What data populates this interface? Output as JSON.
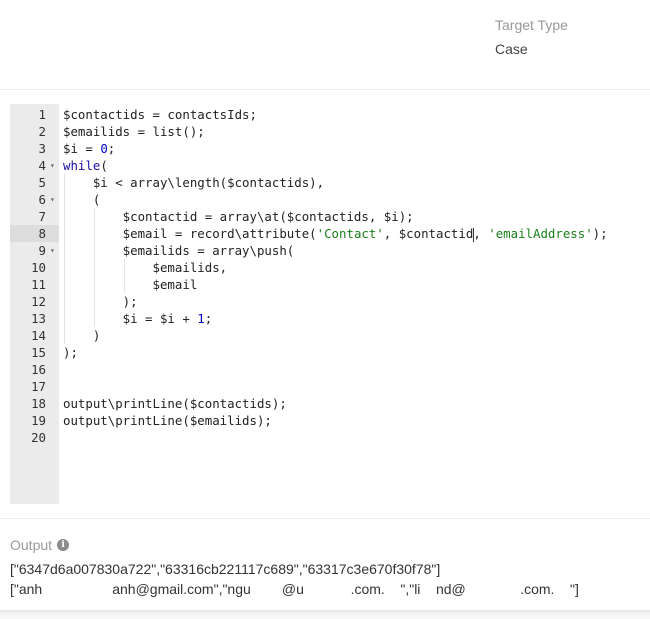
{
  "target_type": {
    "label": "Target Type",
    "value": "Case"
  },
  "editor": {
    "active_line": 8,
    "lines": [
      {
        "n": "1",
        "fold": false,
        "html": "$contactids = contactsIds;"
      },
      {
        "n": "2",
        "fold": false,
        "html": "$emailids = list();"
      },
      {
        "n": "3",
        "fold": false,
        "html": "$i = <span class=\"num\">0</span>;"
      },
      {
        "n": "4",
        "fold": true,
        "html": "<span class=\"kw\">while</span>("
      },
      {
        "n": "5",
        "fold": false,
        "html": "    $i &lt; array\\length($contactids),"
      },
      {
        "n": "6",
        "fold": true,
        "html": "    ("
      },
      {
        "n": "7",
        "fold": false,
        "html": "        $contactid = array\\at($contactids, $i);"
      },
      {
        "n": "8",
        "fold": false,
        "html": "        $email = record\\attribute(<span class=\"str\">'Contact'</span>, $contactid<span class=\"cursor\"></span>, <span class=\"str\">'emailAddress'</span>);"
      },
      {
        "n": "9",
        "fold": true,
        "html": "        $emailids = array\\push("
      },
      {
        "n": "10",
        "fold": false,
        "html": "            $emailids,"
      },
      {
        "n": "11",
        "fold": false,
        "html": "            $email"
      },
      {
        "n": "12",
        "fold": false,
        "html": "        );"
      },
      {
        "n": "13",
        "fold": false,
        "html": "        $i = $i + <span class=\"num\">1</span>;"
      },
      {
        "n": "14",
        "fold": false,
        "html": "    )"
      },
      {
        "n": "15",
        "fold": false,
        "html": ");"
      },
      {
        "n": "16",
        "fold": false,
        "html": ""
      },
      {
        "n": "17",
        "fold": false,
        "html": ""
      },
      {
        "n": "18",
        "fold": false,
        "html": "output\\printLine($contactids);"
      },
      {
        "n": "19",
        "fold": false,
        "html": "output\\printLine($emailids);"
      },
      {
        "n": "20",
        "fold": false,
        "html": ""
      }
    ],
    "fold_glyph": "▾"
  },
  "output": {
    "label": "Output",
    "info_glyph": "i",
    "lines": [
      "[\"6347d6a007830a722\",\"63316cb221117c689\",\"63317c3e670f30f78\"]",
      "[\"anh                  anh@gmail.com\",\"ngu        @u            .com.    \",\"li    nd@              .com.    \"]"
    ]
  }
}
